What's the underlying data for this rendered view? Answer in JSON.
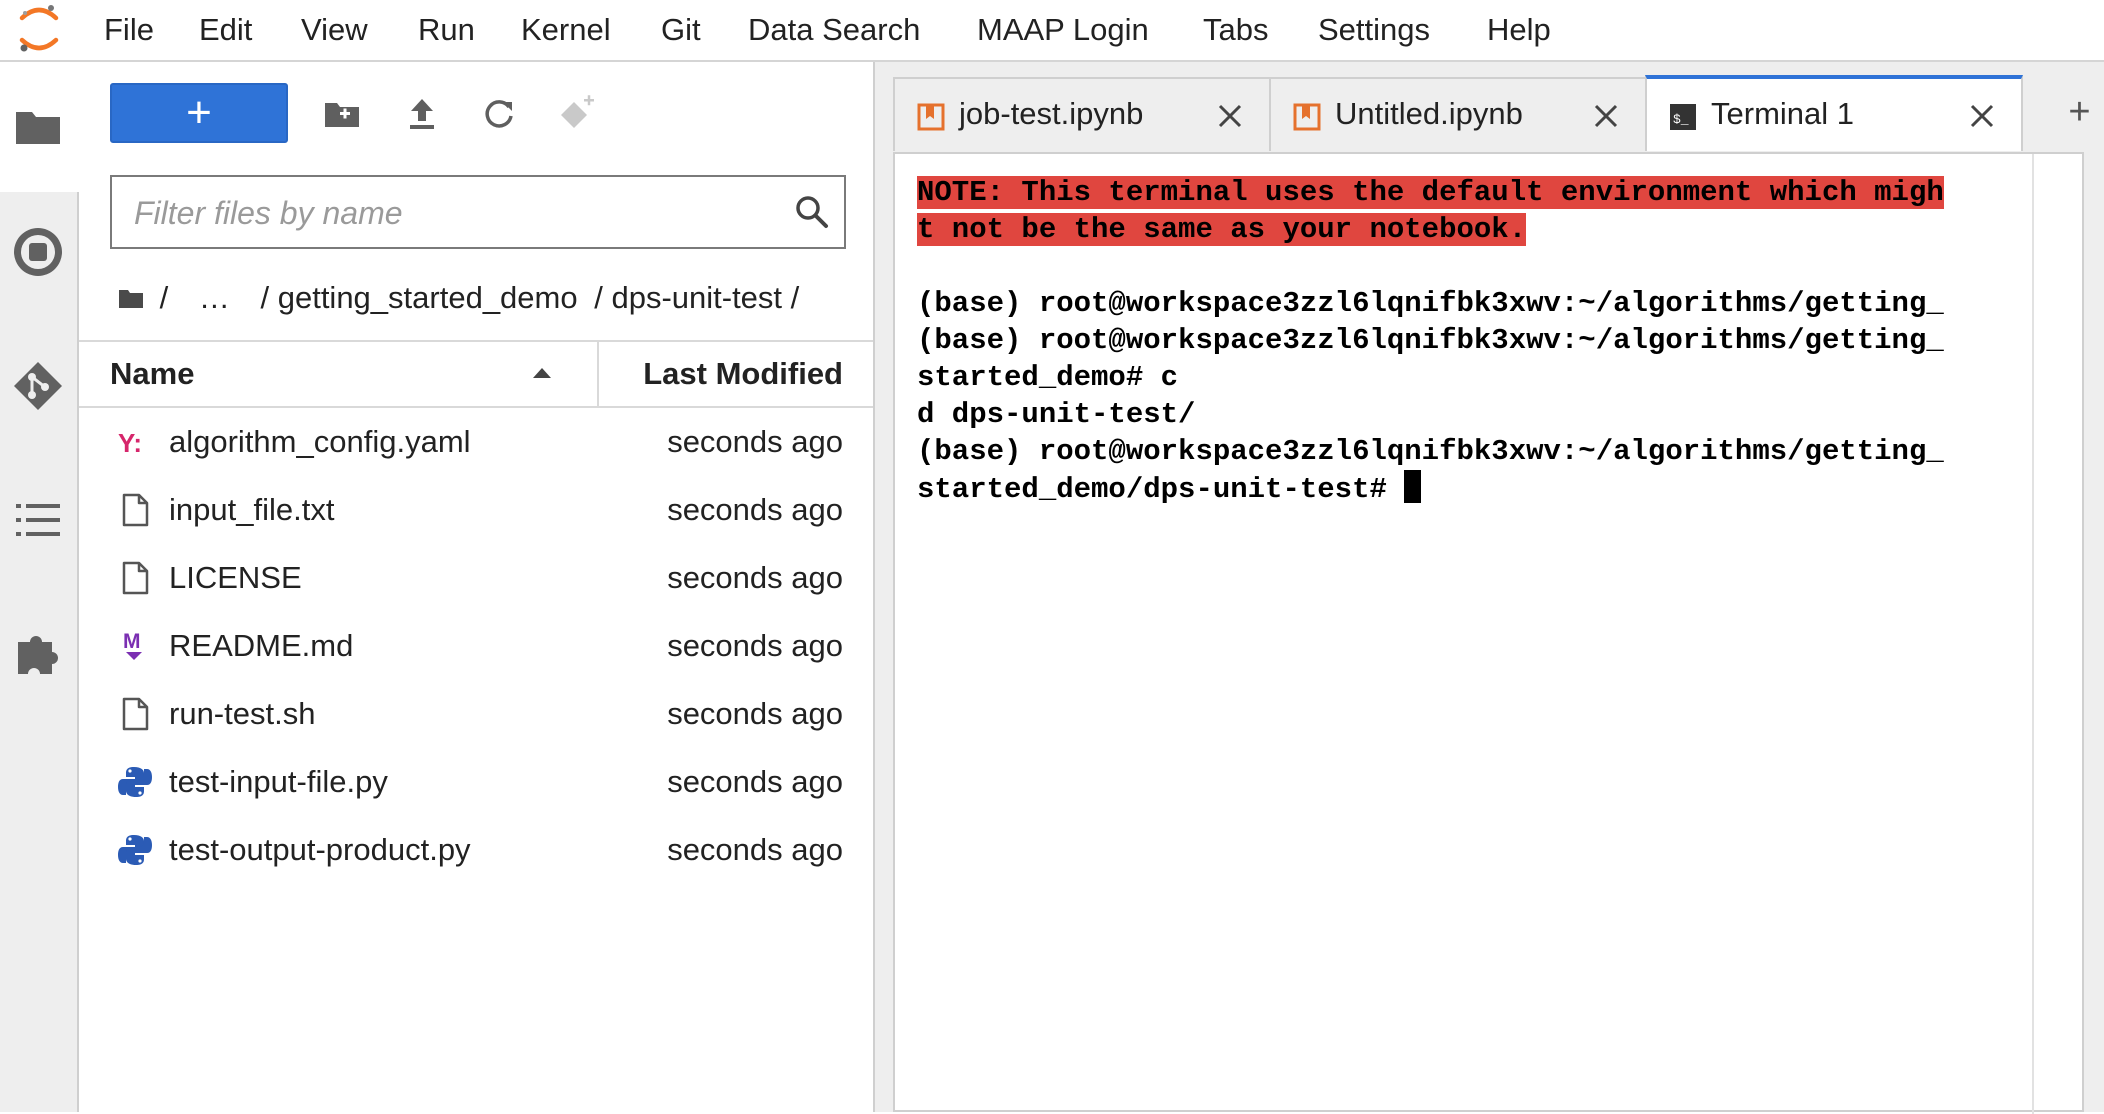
{
  "menubar": {
    "items": [
      "File",
      "Edit",
      "View",
      "Run",
      "Kernel",
      "Git",
      "Data Search",
      "MAAP Login",
      "Tabs",
      "Settings",
      "Help"
    ]
  },
  "activitybar": {
    "icons": [
      "folder-icon",
      "running-icon",
      "git-icon",
      "toc-icon",
      "extension-icon"
    ]
  },
  "filebrowser": {
    "new_button_label": "+",
    "filter_placeholder": "Filter files by name",
    "filter_value": "",
    "breadcrumbs": [
      "/",
      "…",
      "/ getting_started_demo",
      "/ dps-unit-test /"
    ],
    "columns": {
      "name": "Name",
      "modified": "Last Modified"
    },
    "files": [
      {
        "name": "algorithm_config.yaml",
        "modified": "seconds ago",
        "icon": "yaml-icon"
      },
      {
        "name": "input_file.txt",
        "modified": "seconds ago",
        "icon": "file-icon"
      },
      {
        "name": "LICENSE",
        "modified": "seconds ago",
        "icon": "file-icon"
      },
      {
        "name": "README.md",
        "modified": "seconds ago",
        "icon": "markdown-icon"
      },
      {
        "name": "run-test.sh",
        "modified": "seconds ago",
        "icon": "file-icon"
      },
      {
        "name": "test-input-file.py",
        "modified": "seconds ago",
        "icon": "python-icon"
      },
      {
        "name": "test-output-product.py",
        "modified": "seconds ago",
        "icon": "python-icon"
      }
    ]
  },
  "tabs": [
    {
      "label": "job-test.ipynb",
      "icon": "notebook-icon",
      "active": false
    },
    {
      "label": "Untitled.ipynb",
      "icon": "notebook-icon",
      "active": false
    },
    {
      "label": "Terminal 1",
      "icon": "terminal-icon",
      "active": true
    }
  ],
  "new_tab_label": "+",
  "terminal": {
    "warning_lines": [
      "NOTE: This terminal uses the default environment which migh",
      "t not be the same as your notebook."
    ],
    "lines": [
      "",
      "(base) root@workspace3zzl6lqnifbk3xwv:~/algorithms/getting_",
      "(base) root@workspace3zzl6lqnifbk3xwv:~/algorithms/getting_",
      "started_demo# c",
      "d dps-unit-test/",
      "(base) root@workspace3zzl6lqnifbk3xwv:~/algorithms/getting_"
    ],
    "prompt_line": "started_demo/dps-unit-test# "
  },
  "colors": {
    "accent": "#2f73d7",
    "warning_bg": "#e0463f",
    "notebook_orange": "#e5712d",
    "python_blue": "#2b5bb5",
    "yaml_pink": "#d6266b",
    "markdown_purple": "#7b2fb2"
  }
}
